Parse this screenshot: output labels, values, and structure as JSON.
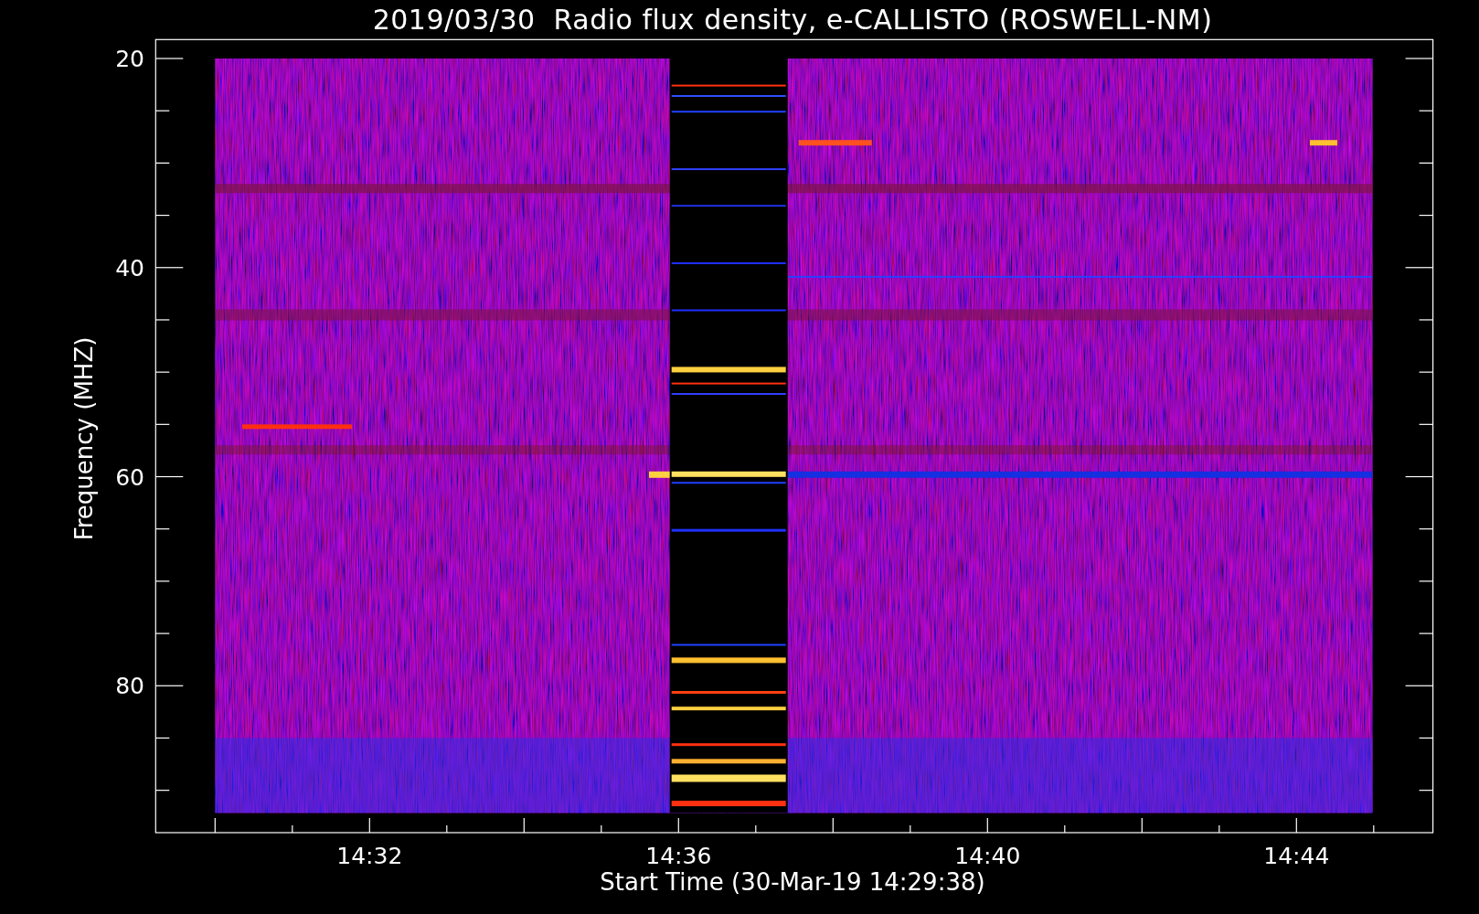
{
  "title": "2019/03/30  Radio flux density, e-CALLISTO (ROSWELL-NM)",
  "y_axis": {
    "label": "Frequency (MHZ)",
    "ticks": [
      "20",
      "40",
      "60",
      "80"
    ]
  },
  "x_axis": {
    "label": "Start Time (30-Mar-19 14:29:38)",
    "ticks": [
      "14:32",
      "14:36",
      "14:40",
      "14:44"
    ]
  }
}
